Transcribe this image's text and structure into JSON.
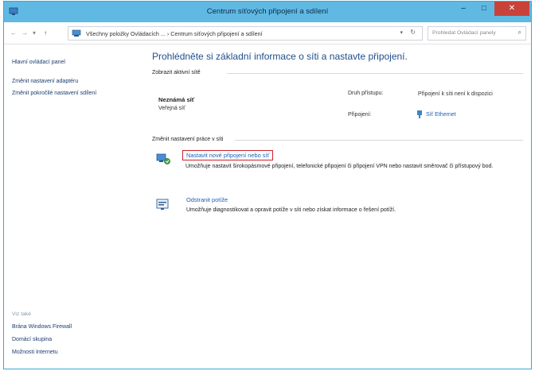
{
  "window": {
    "title": "Centrum síťových připojení a sdílení",
    "controls": {
      "minimize": "–",
      "maximize": "□",
      "close": "✕"
    }
  },
  "address": {
    "back": "←",
    "forward": "→",
    "recent": "▾",
    "up": "↑",
    "path": "Všechny položky Ovládacích ...  ›  Centrum síťových připojení a sdílení",
    "dropdown": "▾",
    "refresh": "↻",
    "search_placeholder": "Prohledat Ovládací panely"
  },
  "sidebar": {
    "home": "Hlavní ovládací panel",
    "links": [
      "Změnit nastavení adaptéru",
      "Změnit pokročilé nastavení sdílení"
    ],
    "see_also_label": "Viz také",
    "see_also": [
      "Brána Windows Firewall",
      "Domácí skupina",
      "Možnosti Internetu"
    ]
  },
  "main": {
    "heading": "Prohlédněte si základní informace o síti a nastavte připojení.",
    "active_section": "Zobrazit aktivní sítě",
    "network": {
      "name": "Neznámá síť",
      "type": "Veřejná síť",
      "access_label": "Druh přístupu:",
      "access_value": "Připojení k síti není k dispozici",
      "connection_label": "Připojení:",
      "connection_value": "Síť Ethernet"
    },
    "change_section": "Změnit nastavení práce v síti",
    "tasks": [
      {
        "title": "Nastavit nové připojení nebo síť",
        "desc": "Umožňuje nastavit širokopásmové připojení, telefonické připojení či připojení VPN nebo nastavit směrovač či přístupový bod."
      },
      {
        "title": "Odstranit potíže",
        "desc": "Umožňuje diagnostikovat a opravit potíže v síti nebo získat informace o řešení potíží."
      }
    ]
  },
  "colors": {
    "titlebar": "#5fb9e3",
    "close": "#c9423a",
    "link": "#1a5fb4",
    "highlight_box": "#d0202a"
  }
}
